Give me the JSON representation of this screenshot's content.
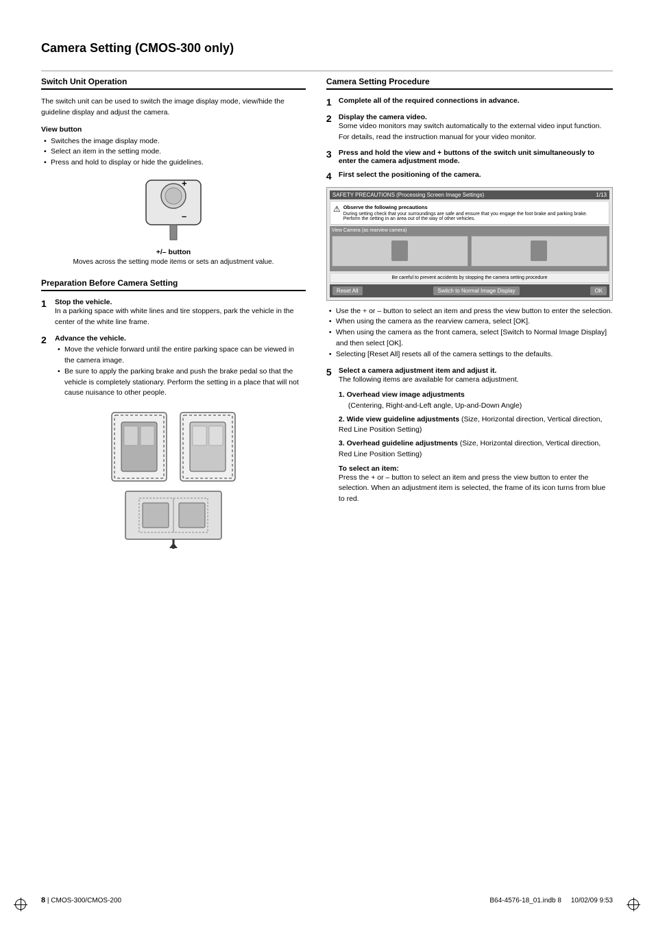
{
  "page": {
    "title": "Camera Setting (CMOS-300 only)",
    "footer": {
      "page_number": "8",
      "separator": "|",
      "model": "CMOS-300/CMOS-200",
      "file_info": "B64-4576-18_01.indb  8",
      "date_info": "10/02/09  9:53"
    }
  },
  "left_column": {
    "switch_unit": {
      "title": "Switch Unit Operation",
      "intro": "The switch unit can be used to switch the image display mode, view/hide the guideline display and adjust the camera.",
      "view_button": {
        "heading": "View button",
        "bullets": [
          "Switches the image display mode.",
          "Select an item in the setting mode.",
          "Press and hold to display or hide the guidelines."
        ]
      },
      "plus_label": "+",
      "minus_label": "–",
      "button_label": "+/– button",
      "button_desc": "Moves across the setting mode items or sets an adjustment value."
    },
    "preparation": {
      "title": "Preparation Before Camera Setting",
      "steps": [
        {
          "num": "1",
          "title": "Stop the vehicle.",
          "desc": "In a parking space with white lines and tire stoppers, park the vehicle in the center of the white line frame."
        },
        {
          "num": "2",
          "title": "Advance the vehicle.",
          "bullets": [
            "Move the vehicle forward until the entire parking space can be viewed in the camera image.",
            "Be sure to apply the parking brake and push the brake pedal so that the vehicle is completely stationary. Perform the setting in a place that will not cause nuisance to other people."
          ]
        }
      ]
    }
  },
  "right_column": {
    "camera_setting": {
      "title": "Camera Setting Procedure",
      "steps": [
        {
          "num": "1",
          "title": "Complete all of the required connections in advance.",
          "desc": ""
        },
        {
          "num": "2",
          "title": "Display the camera video.",
          "desc": "Some video monitors may switch automatically to the external video input function. For details, read the instruction manual for your video monitor."
        },
        {
          "num": "3",
          "title": "Press and hold the view and + buttons of the switch unit simultaneously to enter the camera adjustment mode.",
          "desc": ""
        },
        {
          "num": "4",
          "title": "First select the positioning of the camera.",
          "desc": ""
        }
      ],
      "screen_labels": {
        "header": "SAFETY PRECAUTIONS (Processing Screen Image Settings)",
        "page_indicator": "1/13",
        "warning_icon": "⚠",
        "warning_text": "Observe the following precautions",
        "warning_bullets": [
          "During setting check that your surroundings are safe and ensure that you engage the foot brake and parking brake.",
          "Perform the setting in an area out of the way of other vehicles."
        ],
        "view_label": "View Camera (as rearview camera)",
        "btn_reset": "Reset All",
        "btn_switch": "Switch to Normal Image Display",
        "btn_ok": "OK"
      },
      "screen_instructions": [
        "Use the + or – button to select an item and press the view button to enter the selection.",
        "When using the camera as the rearview camera, select [OK].",
        "When using the camera as the front camera, select [Switch to Normal Image Display] and then select [OK].",
        "Selecting [Reset All] resets all of the camera settings to the defaults."
      ],
      "step5": {
        "num": "5",
        "title": "Select a camera adjustment item and adjust it.",
        "desc": "The following items are available for camera adjustment.",
        "items": [
          {
            "num": "1",
            "title": "Overhead view image adjustments",
            "desc": "(Centering, Right-and-Left angle, Up-and-Down Angle)"
          },
          {
            "num": "2",
            "title": "Wide view guideline adjustments",
            "desc": "(Size, Horizontal direction, Vertical direction, Red Line Position Setting)"
          },
          {
            "num": "3",
            "title": "Overhead guideline adjustments",
            "desc": "(Size, Horizontal direction, Vertical direction, Red Line Position Setting)"
          }
        ],
        "to_select": {
          "heading": "To select an item:",
          "desc": "Press the + or – button to select an item and press the view button to enter the selection. When an adjustment item is selected, the frame of its icon turns from blue to red."
        }
      }
    }
  }
}
